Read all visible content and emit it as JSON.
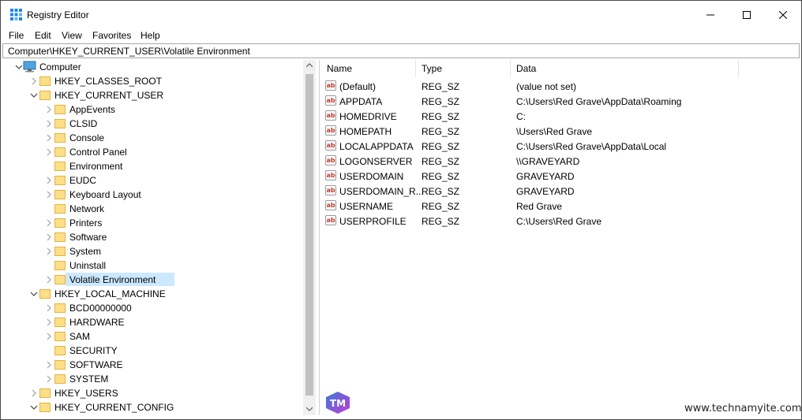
{
  "window": {
    "title": "Registry Editor",
    "minimize_icon": "minimize-icon",
    "maximize_icon": "maximize-icon",
    "close_icon": "close-icon"
  },
  "menu": [
    "File",
    "Edit",
    "View",
    "Favorites",
    "Help"
  ],
  "address": "Computer\\HKEY_CURRENT_USER\\Volatile Environment",
  "tree": [
    {
      "label": "Computer",
      "level": 0,
      "expander": "expanded",
      "icon": "computer-icon"
    },
    {
      "label": "HKEY_CLASSES_ROOT",
      "level": 1,
      "expander": "collapsed"
    },
    {
      "label": "HKEY_CURRENT_USER",
      "level": 1,
      "expander": "expanded"
    },
    {
      "label": "AppEvents",
      "level": 2,
      "expander": "collapsed"
    },
    {
      "label": "CLSID",
      "level": 2,
      "expander": "collapsed"
    },
    {
      "label": "Console",
      "level": 2,
      "expander": "collapsed"
    },
    {
      "label": "Control Panel",
      "level": 2,
      "expander": "collapsed"
    },
    {
      "label": "Environment",
      "level": 2,
      "expander": "none"
    },
    {
      "label": "EUDC",
      "level": 2,
      "expander": "collapsed"
    },
    {
      "label": "Keyboard Layout",
      "level": 2,
      "expander": "collapsed"
    },
    {
      "label": "Network",
      "level": 2,
      "expander": "none"
    },
    {
      "label": "Printers",
      "level": 2,
      "expander": "collapsed"
    },
    {
      "label": "Software",
      "level": 2,
      "expander": "collapsed"
    },
    {
      "label": "System",
      "level": 2,
      "expander": "collapsed"
    },
    {
      "label": "Uninstall",
      "level": 2,
      "expander": "none"
    },
    {
      "label": "Volatile Environment",
      "level": 2,
      "expander": "collapsed",
      "selected": true
    },
    {
      "label": "HKEY_LOCAL_MACHINE",
      "level": 1,
      "expander": "expanded"
    },
    {
      "label": "BCD00000000",
      "level": 2,
      "expander": "collapsed"
    },
    {
      "label": "HARDWARE",
      "level": 2,
      "expander": "collapsed"
    },
    {
      "label": "SAM",
      "level": 2,
      "expander": "collapsed"
    },
    {
      "label": "SECURITY",
      "level": 2,
      "expander": "none"
    },
    {
      "label": "SOFTWARE",
      "level": 2,
      "expander": "collapsed"
    },
    {
      "label": "SYSTEM",
      "level": 2,
      "expander": "collapsed"
    },
    {
      "label": "HKEY_USERS",
      "level": 1,
      "expander": "collapsed"
    },
    {
      "label": "HKEY_CURRENT_CONFIG",
      "level": 1,
      "expander": "expanded"
    }
  ],
  "columns": [
    "Name",
    "Type",
    "Data"
  ],
  "values": [
    {
      "name": "(Default)",
      "type": "REG_SZ",
      "data": "(value not set)"
    },
    {
      "name": "APPDATA",
      "type": "REG_SZ",
      "data": "C:\\Users\\Red Grave\\AppData\\Roaming"
    },
    {
      "name": "HOMEDRIVE",
      "type": "REG_SZ",
      "data": "C:"
    },
    {
      "name": "HOMEPATH",
      "type": "REG_SZ",
      "data": "\\Users\\Red Grave"
    },
    {
      "name": "LOCALAPPDATA",
      "type": "REG_SZ",
      "data": "C:\\Users\\Red Grave\\AppData\\Local"
    },
    {
      "name": "LOGONSERVER",
      "type": "REG_SZ",
      "data": "\\\\GRAVEYARD"
    },
    {
      "name": "USERDOMAIN",
      "type": "REG_SZ",
      "data": "GRAVEYARD"
    },
    {
      "name": "USERDOMAIN_R...",
      "type": "REG_SZ",
      "data": "GRAVEYARD"
    },
    {
      "name": "USERNAME",
      "type": "REG_SZ",
      "data": "Red Grave"
    },
    {
      "name": "USERPROFILE",
      "type": "REG_SZ",
      "data": "C:\\Users\\Red Grave"
    }
  ],
  "value_icon_text": "ab",
  "watermark": {
    "text": "www.technamyite.com",
    "logo_text": "TM"
  },
  "colors": {
    "selection": "#cce8ff",
    "folder": "#fcdf86",
    "value_icon": "#c0392b",
    "watermark_logo_start": "#3a7bd5",
    "watermark_logo_end": "#c13bd6"
  }
}
